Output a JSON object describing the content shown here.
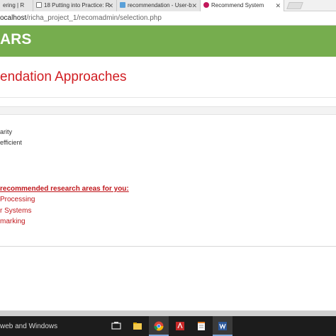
{
  "browser": {
    "tabs": [
      {
        "label": "ering | R",
        "active": false
      },
      {
        "label": "18 Putting into Practice: R",
        "active": false
      },
      {
        "label": "recommendation - User-b",
        "active": false
      },
      {
        "label": "Recommend System",
        "active": true
      }
    ],
    "close_glyph": "✕",
    "url_host": "ocalhost",
    "url_path": "/richa_project_1/recomadmin/selection.php"
  },
  "header": {
    "brand": "ARS",
    "color": "#76ad4e"
  },
  "main": {
    "title": "endation Approaches",
    "options": [
      {
        "label": "arity"
      },
      {
        "label": "efficient"
      }
    ],
    "recommended_heading": "recommended research areas for you:",
    "recommended_items": [
      {
        "label": "Processing"
      },
      {
        "label": "r Systems"
      },
      {
        "label": " marking"
      }
    ],
    "accent_color": "#c0171c"
  },
  "taskbar": {
    "search_text": "web and Windows",
    "apps": [
      {
        "name": "task-view-icon"
      },
      {
        "name": "file-explorer-icon"
      },
      {
        "name": "chrome-icon"
      },
      {
        "name": "pdf-reader-icon"
      },
      {
        "name": "notepad-icon"
      },
      {
        "name": "word-icon"
      }
    ]
  }
}
